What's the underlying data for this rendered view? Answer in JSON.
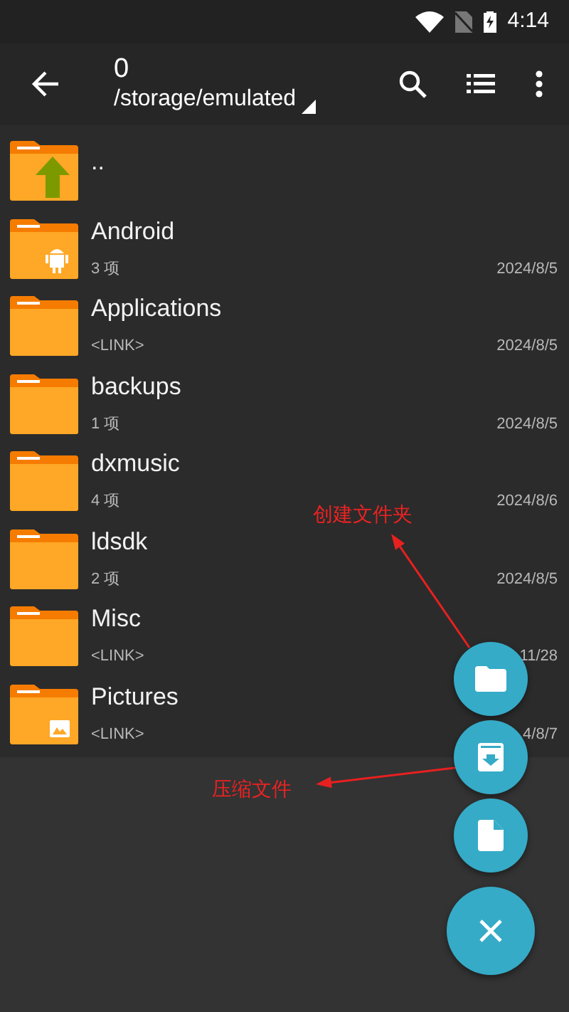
{
  "status_bar": {
    "time": "4:14"
  },
  "toolbar": {
    "title": "0",
    "path": "/storage/emulated"
  },
  "files": [
    {
      "kind": "parent",
      "name": ".."
    },
    {
      "kind": "android",
      "name": "Android",
      "info": "3 项",
      "date": "2024/8/5"
    },
    {
      "kind": "folder",
      "name": "Applications",
      "info": "<LINK>",
      "date": "2024/8/5"
    },
    {
      "kind": "folder",
      "name": "backups",
      "info": "1 项",
      "date": "2024/8/5"
    },
    {
      "kind": "folder",
      "name": "dxmusic",
      "info": "4 项",
      "date": "2024/8/6"
    },
    {
      "kind": "folder",
      "name": "ldsdk",
      "info": "2 项",
      "date": "2024/8/5"
    },
    {
      "kind": "folder",
      "name": "Misc",
      "info": "<LINK>",
      "date": "11/28"
    },
    {
      "kind": "pictures",
      "name": "Pictures",
      "info": "<LINK>",
      "date": "4/8/7"
    }
  ],
  "fab_actions": [
    {
      "kind": "folder"
    },
    {
      "kind": "archive"
    },
    {
      "kind": "file"
    },
    {
      "kind": "close"
    }
  ],
  "annotations": [
    {
      "text": "创建文件夹"
    },
    {
      "text": "压缩文件"
    }
  ]
}
